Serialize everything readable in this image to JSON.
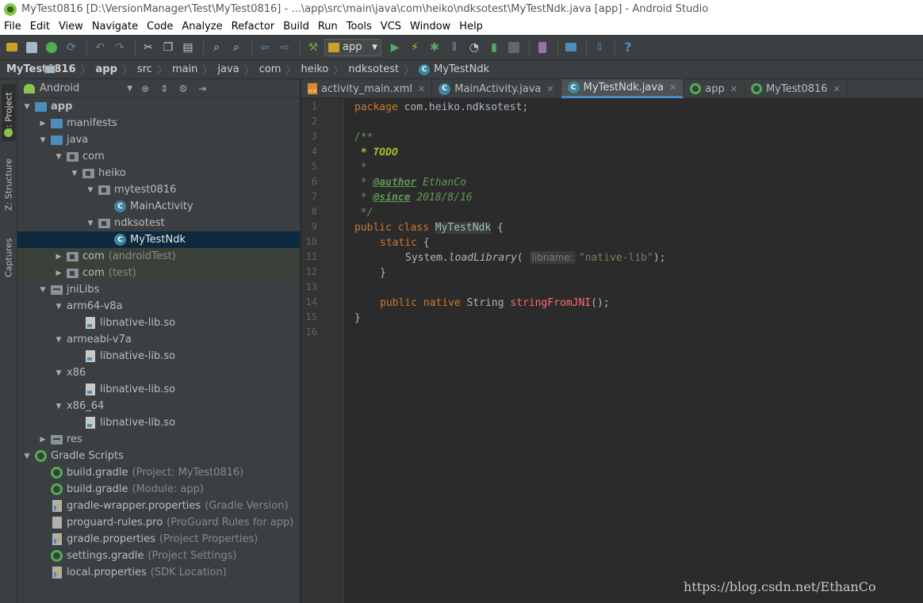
{
  "window": {
    "title": "MyTest0816 [D:\\VersionManager\\Test\\MyTest0816] - ...\\app\\src\\main\\java\\com\\heiko\\ndksotest\\MyTestNdk.java [app] - Android Studio"
  },
  "menu": [
    "File",
    "Edit",
    "View",
    "Navigate",
    "Code",
    "Analyze",
    "Refactor",
    "Build",
    "Run",
    "Tools",
    "VCS",
    "Window",
    "Help"
  ],
  "toolbar": {
    "run_config": "app",
    "help": "?"
  },
  "breadcrumb": [
    "MyTest0816",
    "app",
    "src",
    "main",
    "java",
    "com",
    "heiko",
    "ndksotest",
    "MyTestNdk"
  ],
  "side_tabs": {
    "project": "1: Project",
    "structure": "Z: Structure",
    "captures": "Captures"
  },
  "project_panel": {
    "view_mode": "Android"
  },
  "tree": {
    "app": "app",
    "manifests": "manifests",
    "java": "java",
    "com": "com",
    "heiko": "heiko",
    "mytest0816": "mytest0816",
    "main_activity": "MainActivity",
    "ndksotest": "ndksotest",
    "my_test_ndk": "MyTestNdk",
    "com_android_test": "com",
    "com_android_test_hint": "(androidTest)",
    "com_test": "com",
    "com_test_hint": "(test)",
    "jni_libs": "jniLibs",
    "arm64": "arm64-v8a",
    "so1": "libnative-lib.so",
    "armeabi": "armeabi-v7a",
    "so2": "libnative-lib.so",
    "x86": "x86",
    "so3": "libnative-lib.so",
    "x86_64": "x86_64",
    "so4": "libnative-lib.so",
    "res": "res",
    "gradle_scripts": "Gradle Scripts",
    "build_project": "build.gradle",
    "build_project_hint": "(Project: MyTest0816)",
    "build_module": "build.gradle",
    "build_module_hint": "(Module: app)",
    "wrapper": "gradle-wrapper.properties",
    "wrapper_hint": "(Gradle Version)",
    "proguard": "proguard-rules.pro",
    "proguard_hint": "(ProGuard Rules for app)",
    "gradle_props": "gradle.properties",
    "gradle_props_hint": "(Project Properties)",
    "settings": "settings.gradle",
    "settings_hint": "(Project Settings)",
    "local_props": "local.properties",
    "local_props_hint": "(SDK Location)"
  },
  "tabs": [
    "activity_main.xml",
    "MainActivity.java",
    "MyTestNdk.java",
    "app",
    "MyTest0816"
  ],
  "editor": {
    "line_numbers": [
      "1",
      "2",
      "3",
      "4",
      "5",
      "6",
      "7",
      "8",
      "9",
      "10",
      "11",
      "12",
      "13",
      "14",
      "15",
      "16"
    ],
    "package_kw": "package",
    "package_name": " com.heiko.ndksotest;",
    "doc_open": "/**",
    "doc_todo": " * TODO",
    "doc_star": " *",
    "doc_author_prefix": " * ",
    "doc_author_tag": "@author",
    "doc_author_val": " EthanCo",
    "doc_since_tag": "@since",
    "doc_since_val": " 2018/8/16",
    "doc_close": " */",
    "class_kw": "public class ",
    "class_name": "MyTestNdk",
    "class_rest": " {",
    "static_kw": "static",
    "static_rest": " {",
    "sys": "System.",
    "load_lib": "loadLibrary",
    "paren_open": "( ",
    "param_hint": "libname:",
    "lib_str": "\"native-lib\"",
    "paren_close": ");",
    "close_brace": "}",
    "native_kw": "public native ",
    "string_type": "String ",
    "jni_fn": "stringFromJNI",
    "jni_rest": "();",
    "end_brace": "}"
  },
  "watermark": "https://blog.csdn.net/EthanCo"
}
